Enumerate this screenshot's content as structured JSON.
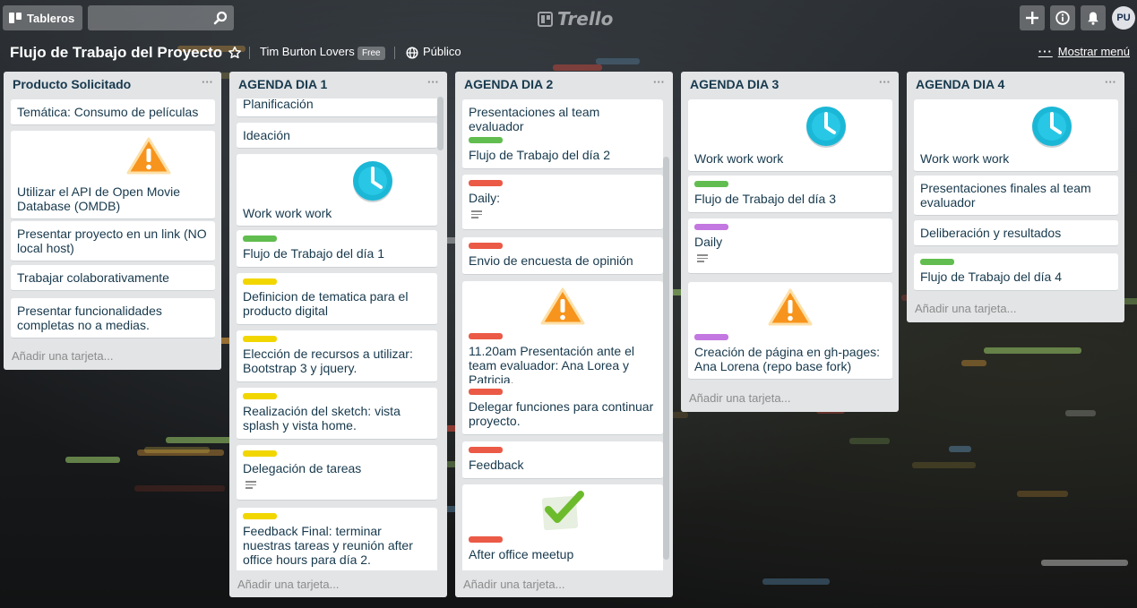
{
  "header": {
    "boards_label": "Tableros",
    "search_placeholder": "",
    "logo_text": "Trello",
    "avatar_initials": "PU"
  },
  "board": {
    "title": "Flujo de Trabajo del Proyecto",
    "team": "Tim Burton Lovers",
    "plan_badge": "Free",
    "visibility": "Público",
    "menu_label": "Mostrar menú"
  },
  "add_card_label": "Añadir una tarjeta...",
  "colors": {
    "label_green": "#61bd4f",
    "label_yellow": "#f2d600",
    "label_red": "#eb5a46",
    "label_purple": "#c377e0",
    "list_bg": "#e2e4e6"
  },
  "lists": [
    {
      "title": "Producto Solicitado",
      "cards": [
        {
          "text": "Temática: Consumo de películas"
        },
        {
          "text": "Utilizar el API de Open Movie Database (OMDB)",
          "cover": "warning-icon"
        },
        {
          "text": "Presentar proyecto en un link (NO local host)"
        },
        {
          "text": "Trabajar colaborativamente"
        },
        {
          "text": "Presentar funcionalidades completas no a medias."
        }
      ]
    },
    {
      "title": "AGENDA DIA 1",
      "cards": [
        {
          "text": "Planificación"
        },
        {
          "text": "Ideación"
        },
        {
          "text": "Work work work",
          "cover": "clock-icon"
        },
        {
          "text": "Flujo de Trabajo del día 1",
          "label": "green"
        },
        {
          "text": "Definicion de tematica para el producto digital",
          "label": "yellow"
        },
        {
          "text": "Elección de recursos a utilizar: Bootstrap 3 y jquery.",
          "label": "yellow"
        },
        {
          "text": "Realización del sketch: vista splash y vista home.",
          "label": "yellow"
        },
        {
          "text": "Delegación de tareas",
          "label": "yellow",
          "has_description": true
        },
        {
          "text": "Feedback Final: terminar nuestras tareas y reunión after office hours para día 2.",
          "label": "yellow"
        }
      ]
    },
    {
      "title": "AGENDA DIA 2",
      "cards": [
        {
          "text": "Presentaciones al team evaluador"
        },
        {
          "text": "Flujo de Trabajo del día 2",
          "label": "green"
        },
        {
          "text": "Daily:",
          "label": "red",
          "has_description": true
        },
        {
          "text": "Envio de encuesta de opinión",
          "label": "red"
        },
        {
          "text": "11.20am Presentación ante el team evaluador: Ana Lorea y Patricia.",
          "label": "red",
          "cover": "warning-icon"
        },
        {
          "text": "Delegar funciones para continuar proyecto.",
          "label": "red"
        },
        {
          "text": "Feedback",
          "label": "red"
        },
        {
          "text": "After office meetup",
          "label": "red",
          "cover": "check-icon"
        }
      ]
    },
    {
      "title": "AGENDA DIA 3",
      "cards": [
        {
          "text": "Work work work",
          "cover": "clock-icon"
        },
        {
          "text": "Flujo de Trabajo del día 3",
          "label": "green"
        },
        {
          "text": "Daily",
          "label": "purple",
          "has_description": true
        },
        {
          "text": "Creación de página en gh-pages: Ana Lorena (repo base fork)",
          "label": "purple",
          "cover": "warning-icon"
        }
      ]
    },
    {
      "title": "AGENDA DIA 4",
      "cards": [
        {
          "text": "Work work work",
          "cover": "clock-icon"
        },
        {
          "text": "Presentaciones finales al team evaluador"
        },
        {
          "text": "Deliberación y resultados"
        },
        {
          "text": "Flujo de Trabajo del día 4",
          "label": "green"
        }
      ]
    }
  ]
}
